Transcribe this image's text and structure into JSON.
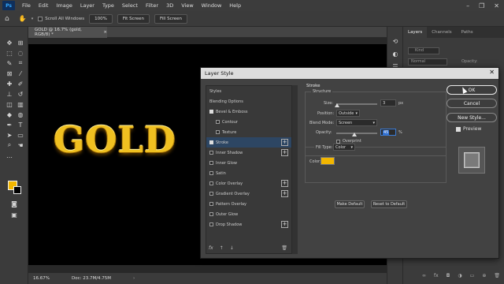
{
  "app": {
    "logo": "Ps",
    "menu": [
      "File",
      "Edit",
      "Image",
      "Layer",
      "Type",
      "Select",
      "Filter",
      "3D",
      "View",
      "Window",
      "Help"
    ],
    "window_controls": [
      "–",
      "❐",
      "✕"
    ]
  },
  "options_bar": {
    "scroll_all_windows": "Scroll All Windows",
    "zoom": "100%",
    "fit_screen": "Fit Screen",
    "fill_screen": "Fill Screen"
  },
  "document": {
    "tab_title": "GOLD @ 16.7% (gold, RGB/8) *",
    "tab_close": "×",
    "canvas_text": "GOLD",
    "zoom_status": "16.67%",
    "doc_status": "Doc: 23.7M/4.75M"
  },
  "panels": {
    "tabs": [
      "Layers",
      "Channels",
      "Paths"
    ],
    "active_tab": "Layers",
    "kind": "Kind",
    "mode": "Normal",
    "opacity": "Opacity:"
  },
  "dialog": {
    "title": "Layer Style",
    "close": "✕",
    "styles": [
      {
        "label": "Styles",
        "checkbox": false,
        "checked": false,
        "plus": false
      },
      {
        "label": "Blending Options",
        "checkbox": false,
        "checked": false,
        "plus": false
      },
      {
        "label": "Bevel & Emboss",
        "checkbox": true,
        "checked": true,
        "plus": false
      },
      {
        "label": "Contour",
        "checkbox": true,
        "checked": false,
        "plus": false,
        "indent": true
      },
      {
        "label": "Texture",
        "checkbox": true,
        "checked": false,
        "plus": false,
        "indent": true
      },
      {
        "label": "Stroke",
        "checkbox": true,
        "checked": true,
        "plus": true,
        "selected": true
      },
      {
        "label": "Inner Shadow",
        "checkbox": true,
        "checked": false,
        "plus": true
      },
      {
        "label": "Inner Glow",
        "checkbox": true,
        "checked": false,
        "plus": false
      },
      {
        "label": "Satin",
        "checkbox": true,
        "checked": false,
        "plus": false
      },
      {
        "label": "Color Overlay",
        "checkbox": true,
        "checked": false,
        "plus": true
      },
      {
        "label": "Gradient Overlay",
        "checkbox": true,
        "checked": false,
        "plus": true
      },
      {
        "label": "Pattern Overlay",
        "checkbox": true,
        "checked": false,
        "plus": false
      },
      {
        "label": "Outer Glow",
        "checkbox": true,
        "checked": false,
        "plus": false
      },
      {
        "label": "Drop Shadow",
        "checkbox": true,
        "checked": false,
        "plus": true
      }
    ],
    "footer_icons": [
      "fx",
      "↑",
      "↓",
      "🗑"
    ],
    "stroke": {
      "heading": "Stroke",
      "structure": "Structure",
      "size_label": "Size:",
      "size_value": "3",
      "size_unit": "px",
      "position_label": "Position:",
      "position_value": "Outside",
      "blend_label": "Blend Mode:",
      "blend_value": "Screen",
      "opacity_label": "Opacity:",
      "opacity_value": "45",
      "opacity_unit": "%",
      "opacity_level": 0.45,
      "size_level": 0.03,
      "overprint": "Overprint",
      "fill_type_label": "Fill Type:",
      "fill_type_value": "Color",
      "color_label": "Color:",
      "color_swatch": "#f2b600",
      "make_default": "Make Default",
      "reset_default": "Reset to Default"
    },
    "buttons": {
      "ok": "OK",
      "cancel": "Cancel",
      "new_style": "New Style...",
      "preview": "Preview"
    }
  },
  "colors": {
    "gold": "#f0c020",
    "foreground_swatch": "#f2b600",
    "selected_row": "#2d4663"
  }
}
